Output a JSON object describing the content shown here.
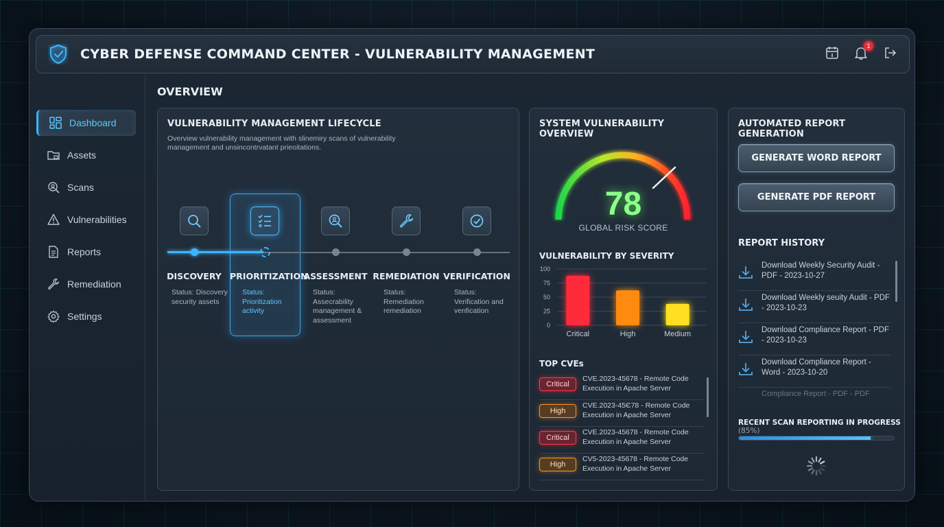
{
  "header": {
    "title": "CYBER DEFENSE COMMAND CENTER - VULNERABILITY MANAGEMENT",
    "notification_count": "1",
    "icons": [
      "shield-icon",
      "calendar-icon",
      "bell-icon",
      "logout-icon"
    ]
  },
  "sidebar": {
    "items": [
      {
        "label": "Dashboard",
        "icon": "dashboard-icon",
        "active": true
      },
      {
        "label": "Assets",
        "icon": "folder-icon"
      },
      {
        "label": "Scans",
        "icon": "scan-icon"
      },
      {
        "label": "Vulnerabilities",
        "icon": "warning-icon"
      },
      {
        "label": "Reports",
        "icon": "document-icon"
      },
      {
        "label": "Remediation",
        "icon": "wrench-icon"
      },
      {
        "label": "Settings",
        "icon": "gear-icon"
      }
    ]
  },
  "main": {
    "overview_title": "OVERVIEW",
    "lifecycle": {
      "title": "VULNERABILITY MANAGEMENT LIFECYCLE",
      "subtitle": "Overview vulnerability management with slinemiry scans of vulnerability management and unsincontrvatant prieoitations.",
      "stages": [
        {
          "name": "DISCOVERY",
          "status": "Status: Discovery security assets",
          "icon": "search-icon"
        },
        {
          "name": "PRIORITIZATION",
          "status": "Status: Prioritization activity",
          "icon": "checklist-icon"
        },
        {
          "name": "ASSESSMENT",
          "status": "Status: Assecrability management & assessment",
          "icon": "magnifier-shield-icon"
        },
        {
          "name": "REMEDIATION",
          "status": "Status: Remediation remediation",
          "icon": "wrench-icon"
        },
        {
          "name": "VERIFICATION",
          "status": "Status: Verification and venfication",
          "icon": "check-circle-icon"
        }
      ],
      "active_stage": 1
    },
    "system": {
      "title": "SYSTEM VULNERABILITY OVERVIEW",
      "score": "78",
      "score_label": "GLOBAL RISK SCORE",
      "severity_title": "VULNERABILITY BY SEVERITY",
      "top_cves_title": "TOP CVEs",
      "cves": [
        {
          "severity": "Critical",
          "level": "crit",
          "text": "CVE.2023-45678 - Remote Code Execution in Apache Server"
        },
        {
          "severity": "High",
          "level": "high",
          "text": "CVE.2023-45Є78 - Remote Code Execution in Apache Server"
        },
        {
          "severity": "Critical",
          "level": "crit",
          "text": "CVE.2023-45678 - Remote Code Execution in Apache Server"
        },
        {
          "severity": "High",
          "level": "high",
          "text": "CV5-2023-45678 - Remote Code Execution in Apache Server"
        }
      ]
    },
    "reports": {
      "title": "AUTOMATED REPORT GENERATION",
      "word_button": "GENERATE WORD REPORT",
      "pdf_button": "GENERATE PDF REPORT",
      "history_title": "REPORT HISTORY",
      "history": [
        "Download Weekly Security Audit - PDF - 2023-10-27",
        "Download Weekly seuity Audit - PDF - 2023-10-23",
        "Download Compliance Report - PDF - 2023-10-23",
        "Download Compliance Report - Word - 2023-10-20"
      ],
      "history_faded": "Compliance Report - PDF - PDF",
      "progress_label": "RECENT SCAN REPORTING IN PROGRESS",
      "progress_pct_text": "(85%)",
      "progress_value": 85
    }
  },
  "chart_data": {
    "type": "bar",
    "title": "VULNERABILITY BY SEVERITY",
    "categories": [
      "Critical",
      "High",
      "Medium"
    ],
    "values": [
      88,
      62,
      38
    ],
    "colors": [
      "#ff2a3a",
      "#ff8a10",
      "#ffe020"
    ],
    "ylim": [
      0,
      100
    ],
    "yticks": [
      0,
      25,
      50,
      75,
      100
    ],
    "grid": true
  },
  "colors": {
    "accent": "#3fb5ff",
    "score": "#8dff8a",
    "critical": "#ff3a48",
    "high": "#ff9520",
    "medium": "#ffe020"
  }
}
